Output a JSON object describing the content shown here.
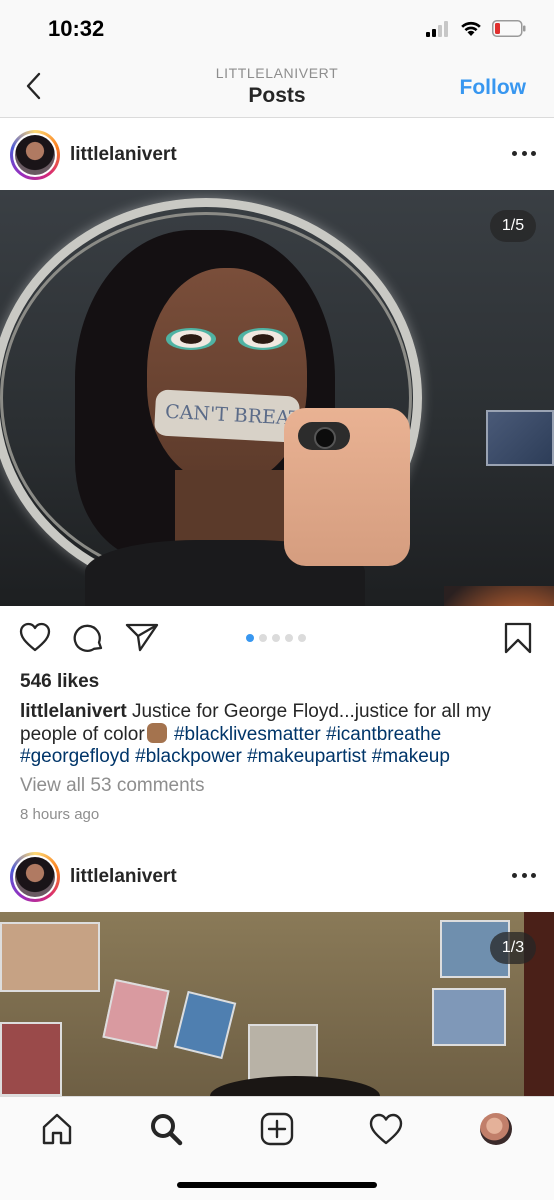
{
  "status_bar": {
    "time": "10:32",
    "signal_icon": "cellular-signal-icon",
    "wifi_icon": "wifi-icon",
    "battery_icon": "battery-low-icon",
    "battery_color": "#e0302f"
  },
  "nav": {
    "subtitle": "LITTLELANIVERT",
    "title": "Posts",
    "follow_label": "Follow",
    "back_icon": "chevron-left-icon",
    "accent_color": "#3897f0"
  },
  "posts": [
    {
      "username": "littlelanivert",
      "counter": "1/5",
      "photo_text": "CAN'T BREAT",
      "active_slide_index": 0,
      "slide_count": 5,
      "likes": "546 likes",
      "caption_user": "littlelanivert",
      "caption_text": "Justice for George Floyd...justice for all my people of color",
      "caption_emoji": "raised-fist-emoji",
      "hashtags": [
        "#blacklivesmatter",
        "#icantbreathe",
        "#georgefloyd",
        "#blackpower",
        "#makeupartist",
        "#makeup"
      ],
      "view_comments": "View all 53 comments",
      "timestamp": "8 hours ago"
    },
    {
      "username": "littlelanivert",
      "counter": "1/3"
    }
  ],
  "tab_bar": {
    "tabs": [
      "home-icon",
      "search-icon",
      "new-post-icon",
      "activity-heart-icon",
      "profile-avatar"
    ]
  }
}
